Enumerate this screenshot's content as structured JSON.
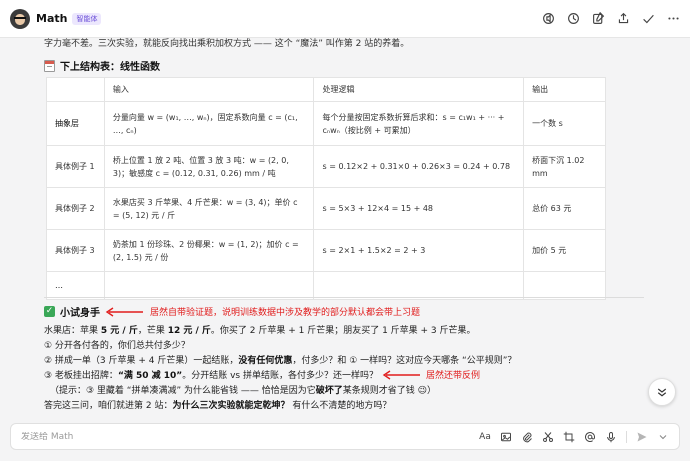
{
  "header": {
    "title": "Math",
    "badge": "智能体"
  },
  "content": {
    "cut_line": "字力毫不差。三次实验，就能反向找出乘积加权方式 —— 这个 “魔法” 叫作第 2 站的养着。",
    "section_title": "下上结构表：线性函数",
    "table": {
      "headers": [
        "",
        "输入",
        "处理逻辑",
        "输出"
      ],
      "rows": [
        {
          "label": "抽象层",
          "input": "分量向量 w = (w₁, …, wₙ)，固定系数向量 c = (c₁, …, cₙ)",
          "logic": "每个分量按固定系数折算后求和：s = c₁w₁ + ··· + cₙwₙ（按比例 + 可累加）",
          "output": "一个数 s"
        },
        {
          "label": "具体例子 1",
          "input": "桥上位置 1 放 2 吨、位置 3 放 3 吨：w = (2, 0, 3)；敏感度 c = (0.12, 0.31, 0.26) mm / 吨",
          "logic": "s = 0.12×2 + 0.31×0 + 0.26×3 = 0.24 + 0.78",
          "output": "桥面下沉 1.02 mm"
        },
        {
          "label": "具体例子 2",
          "input": "水果店买 3 斤苹果、4 斤芒果：w = (3, 4)；单价 c = (5, 12) 元 / 斤",
          "logic": "s = 5×3 + 12×4 = 15 + 48",
          "output": "总价 63 元"
        },
        {
          "label": "具体例子 3",
          "input": "奶茶加 1 份珍珠、2 份椰果：w = (1, 2)；加价 c = (2, 1.5) 元 / 份",
          "logic": "s = 2×1 + 1.5×2 = 2 + 3",
          "output": "加价 5 元"
        },
        {
          "label": "…",
          "input": "",
          "logic": "",
          "output": ""
        }
      ]
    },
    "try_title": "小试身手",
    "annotation_1": "居然自带验证题，说明训练数据中涉及教学的部分默认都会带上习题",
    "annotation_2": "居然还带反例",
    "lines": {
      "l1_a": "水果店：苹果 ",
      "l1_b": "5 元 / 斤",
      "l1_c": "，芒果 ",
      "l1_d": "12 元 / 斤",
      "l1_e": "。你买了 2 斤苹果 + 1 斤芒果；朋友买了 1 斤苹果 + 3 斤芒果。",
      "l2": "① 分开各付各的，你们总共付多少？",
      "l3_a": "② 拼成一单（3 斤苹果 + 4 斤芒果）一起结账，",
      "l3_b": "没有任何优惠",
      "l3_c": "，付多少？和 ① 一样吗？这对应今天哪条 “公平规则”？",
      "l4_a": "③ 老板挂出招牌：",
      "l4_b": "“满 50 减 10”",
      "l4_c": "。分开结账 vs 拼单结账，各付多少？还一样吗？",
      "l5_a": "（提示：③ 里藏着 “拼单凑满减” 为什么能省钱 —— 恰恰是因为它",
      "l5_b": "破坏了",
      "l5_c": "某条规则才省了钱 😉）",
      "l6_a": "答完这三问，咱们就进第 2 站：",
      "l6_b": "为什么三次实验就能定乾坤？",
      "l6_c": " 有什么不清楚的地方吗？"
    }
  },
  "input": {
    "placeholder": "发送给 Math"
  },
  "colors": {
    "annotation": "#e11d1d",
    "badge": "#6b4fd8",
    "check": "#3aa757"
  }
}
